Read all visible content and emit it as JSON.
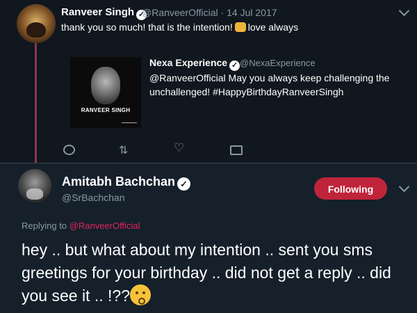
{
  "original_tweet": {
    "author_name": "Ranveer Singh",
    "handle": "@RanveerOfficial",
    "separator": "·",
    "date": "14 Jul 2017",
    "text_before_emoji": "thank you so much! that is the intention!",
    "text_after_emoji": "love always"
  },
  "quoted_tweet": {
    "author_name": "Nexa Experience",
    "handle": "@NexaExperience",
    "text": "@RanveerOfficial May you always keep challenging the unchallenged! #HappyBirthdayRanveerSingh",
    "image_caption": "RANVEER SINGH"
  },
  "actions": {
    "icons": [
      "reply-icon",
      "retweet-icon",
      "like-icon",
      "direct-message-icon"
    ]
  },
  "reply_tweet": {
    "author_name": "Amitabh Bachchan",
    "handle": "@SrBachchan",
    "follow_label": "Following",
    "replying_label": "Replying to",
    "replying_mention": "@RanveerOfficial",
    "text": "hey .. but what about my intention .. sent you sms greetings for your birthday .. did not get a reply .. did you see it .. !??"
  },
  "colors": {
    "background": "#15202b",
    "top_background": "#10171e",
    "thread_line": "#8e3550",
    "follow_button": "#c0243b",
    "mention": "#e0245e",
    "secondary_text": "#8899a6"
  }
}
